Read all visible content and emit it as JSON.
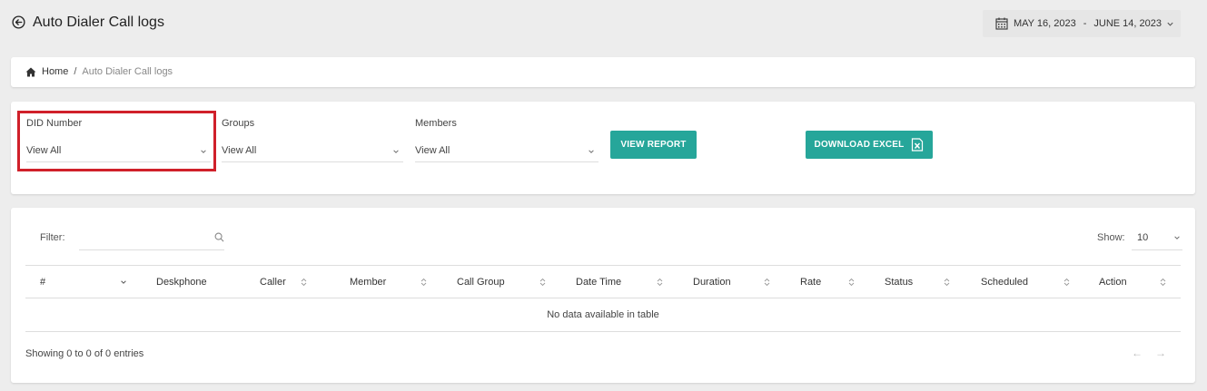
{
  "header": {
    "title": "Auto Dialer Call logs"
  },
  "date_range": {
    "start": "MAY 16, 2023",
    "separator": "-",
    "end": "JUNE 14, 2023"
  },
  "breadcrumb": {
    "home": "Home",
    "separator": "/",
    "current": "Auto Dialer Call logs"
  },
  "filters": {
    "did": {
      "label": "DID Number",
      "value": "View All"
    },
    "groups": {
      "label": "Groups",
      "value": "View All"
    },
    "members": {
      "label": "Members",
      "value": "View All"
    },
    "view_report": "VIEW REPORT",
    "download_excel": "DOWNLOAD EXCEL"
  },
  "table": {
    "filter_label": "Filter:",
    "show_label": "Show:",
    "show_value": "10",
    "columns": [
      "#",
      "Deskphone",
      "Caller",
      "Member",
      "Call Group",
      "Date Time",
      "Duration",
      "Rate",
      "Status",
      "Scheduled",
      "Action"
    ],
    "empty_text": "No data available in table",
    "info": "Showing 0 to 0 of 0 entries",
    "prev": "←",
    "next": "→"
  },
  "colors": {
    "accent": "#26a69a",
    "highlight": "#d0202a"
  }
}
